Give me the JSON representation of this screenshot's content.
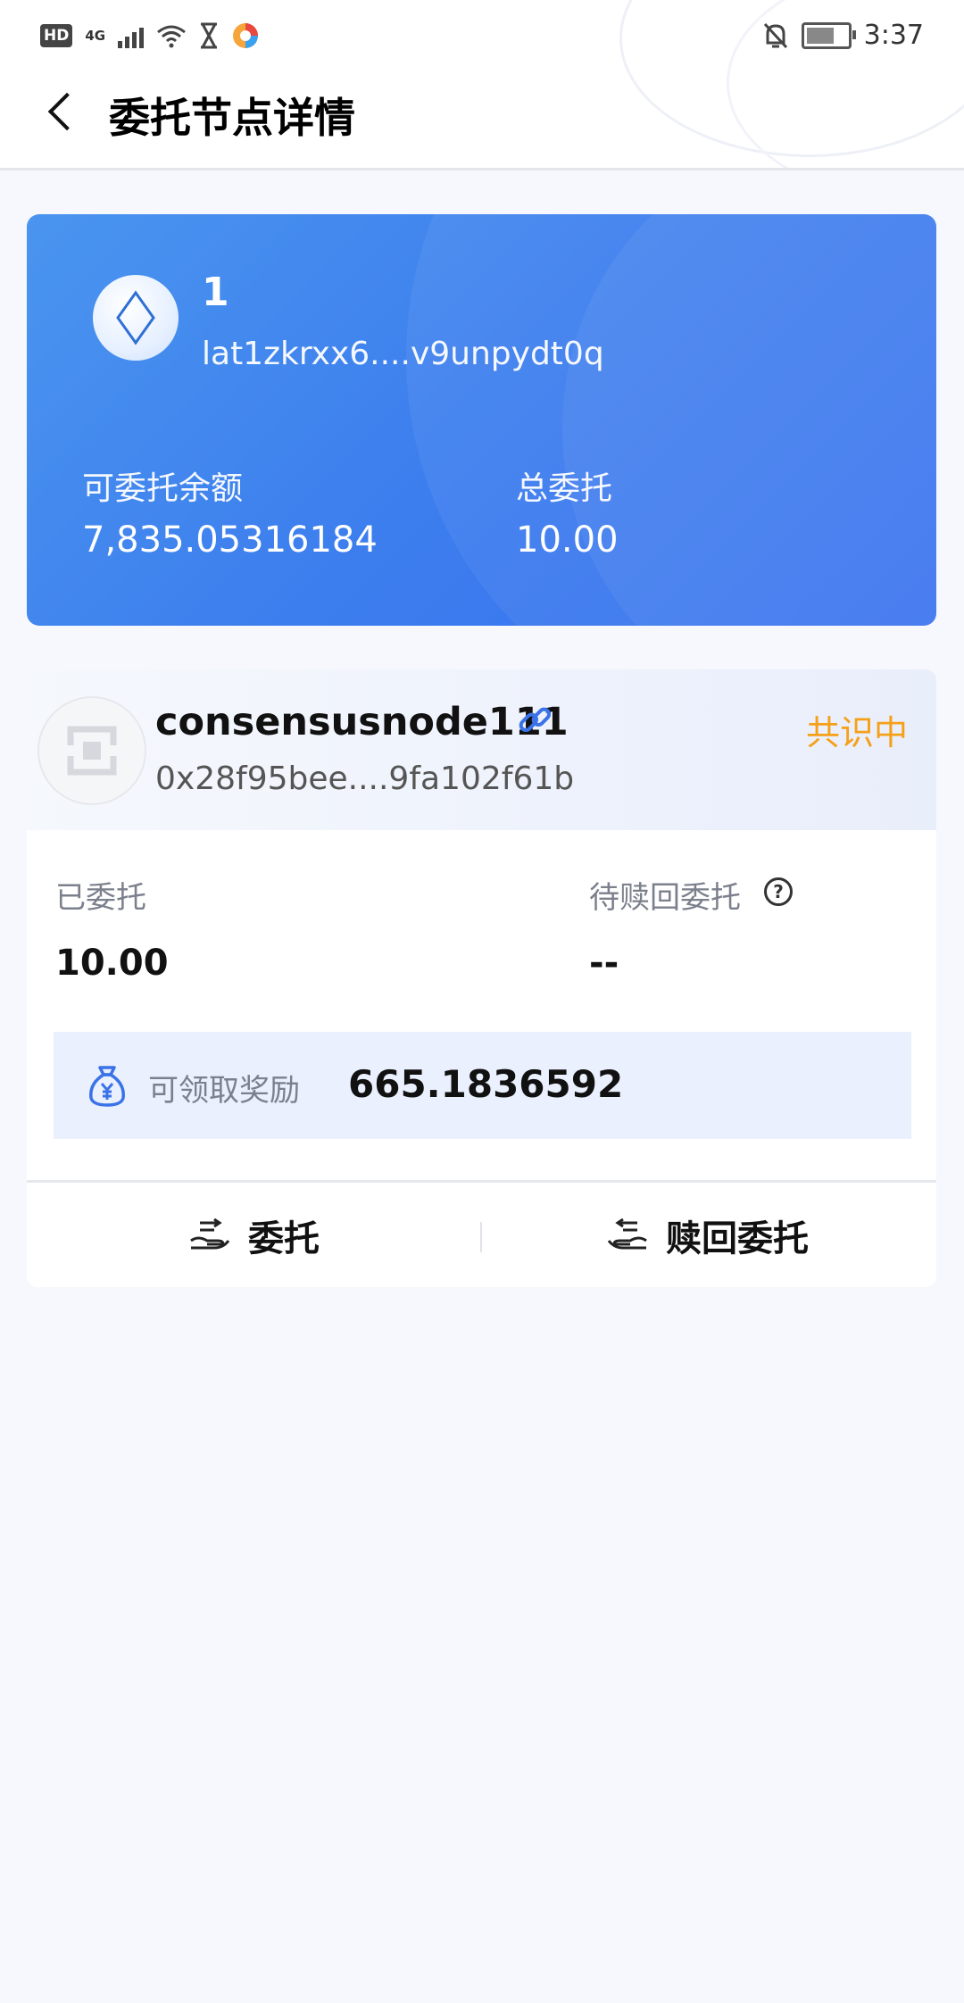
{
  "status_bar": {
    "left_icons": [
      "hd-icon",
      "signal-4g-icon",
      "wifi-icon",
      "hourglass-icon",
      "app-color-icon"
    ],
    "hd_label": "HD",
    "network": "4G",
    "time": "3:37",
    "right_icons": [
      "bell-off-icon",
      "battery-icon"
    ]
  },
  "header": {
    "title": "委托节点详情"
  },
  "wallet": {
    "name": "1",
    "address": "lat1zkrxx6....v9unpydt0q",
    "available_label": "可委托余额",
    "available_value": "7,835.05316184",
    "total_label": "总委托",
    "total_value": "10.00"
  },
  "node": {
    "name": "consensusnode111",
    "address": "0x28f95bee....9fa102f61b",
    "status": "共识中",
    "status_color": "#f5a019",
    "delegated_label": "已委托",
    "delegated_value": "10.00",
    "pending_label": "待赎回委托",
    "pending_value": "--",
    "reward_label": "可领取奖励",
    "reward_value": "665.1836592"
  },
  "actions": {
    "delegate_label": "委托",
    "withdraw_label": "赎回委托"
  },
  "colors": {
    "accent_blue": "#3e80ee",
    "background": "#f7f8fd"
  }
}
